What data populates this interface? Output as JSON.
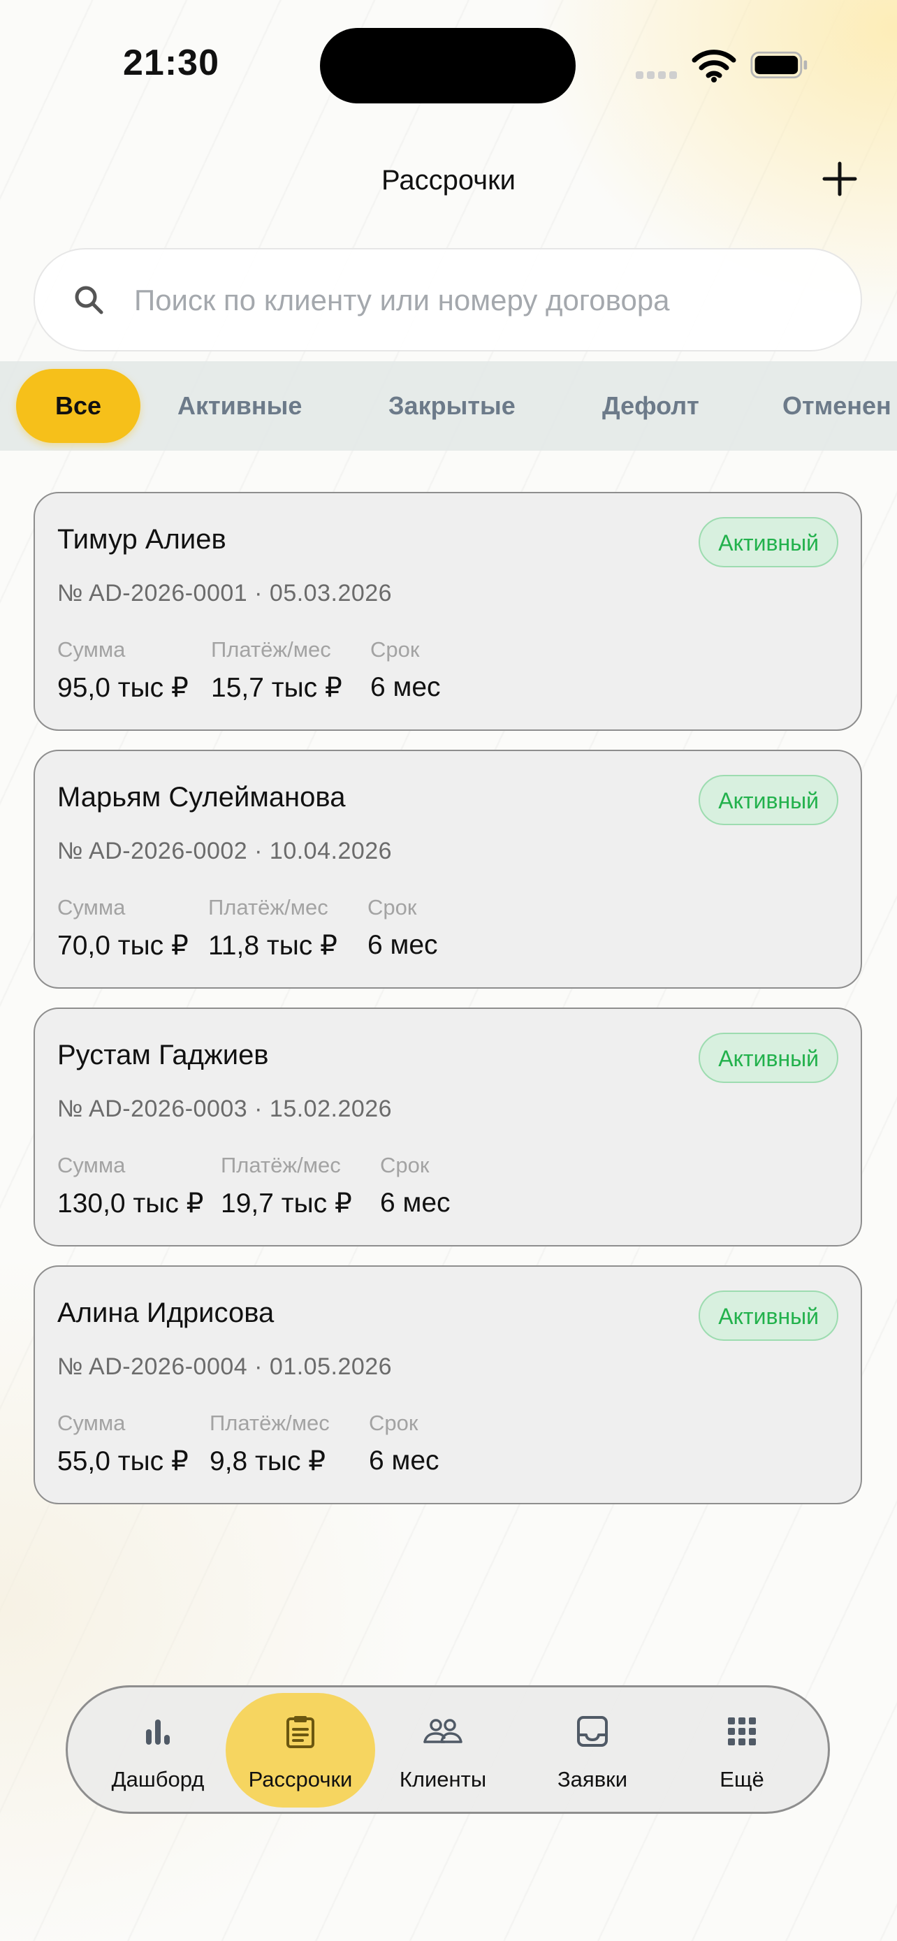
{
  "status_bar": {
    "time": "21:30"
  },
  "header": {
    "title": "Рассрочки",
    "add_icon": "plus-icon"
  },
  "search": {
    "placeholder": "Поиск по клиенту или номеру договора",
    "value": ""
  },
  "filters": [
    {
      "label": "Все",
      "active": true
    },
    {
      "label": "Активные",
      "active": false
    },
    {
      "label": "Закрытые",
      "active": false
    },
    {
      "label": "Дефолт",
      "active": false
    },
    {
      "label": "Отменен",
      "active": false
    }
  ],
  "labels": {
    "amount": "Сумма",
    "payment": "Платёж/мес",
    "term": "Срок"
  },
  "colors": {
    "accent": "#f6c01a",
    "badge_green": "#22b14c",
    "nav_active": "#f6d560"
  },
  "cards": [
    {
      "name": "Тимур Алиев",
      "status": "Активный",
      "contract": "№ AD-2026-0001 · 05.03.2026",
      "amount": "95,0 тыс ₽",
      "payment": "15,7 тыс ₽",
      "term": "6 мес"
    },
    {
      "name": "Марьям Сулейманова",
      "status": "Активный",
      "contract": "№ AD-2026-0002 · 10.04.2026",
      "amount": "70,0 тыс ₽",
      "payment": "11,8 тыс ₽",
      "term": "6 мес"
    },
    {
      "name": "Рустам Гаджиев",
      "status": "Активный",
      "contract": "№ AD-2026-0003 · 15.02.2026",
      "amount": "130,0 тыс ₽",
      "payment": "19,7 тыс ₽",
      "term": "6 мес"
    },
    {
      "name": "Алина Идрисова",
      "status": "Активный",
      "contract": "№ AD-2026-0004 · 01.05.2026",
      "amount": "55,0 тыс ₽",
      "payment": "9,8 тыс ₽",
      "term": "6 мес"
    }
  ],
  "nav": [
    {
      "label": "Дашборд",
      "icon": "bar-chart-icon",
      "active": false
    },
    {
      "label": "Рассрочки",
      "icon": "clipboard-icon",
      "active": true
    },
    {
      "label": "Клиенты",
      "icon": "users-icon",
      "active": false
    },
    {
      "label": "Заявки",
      "icon": "inbox-icon",
      "active": false
    },
    {
      "label": "Ещё",
      "icon": "grid-icon",
      "active": false
    }
  ]
}
